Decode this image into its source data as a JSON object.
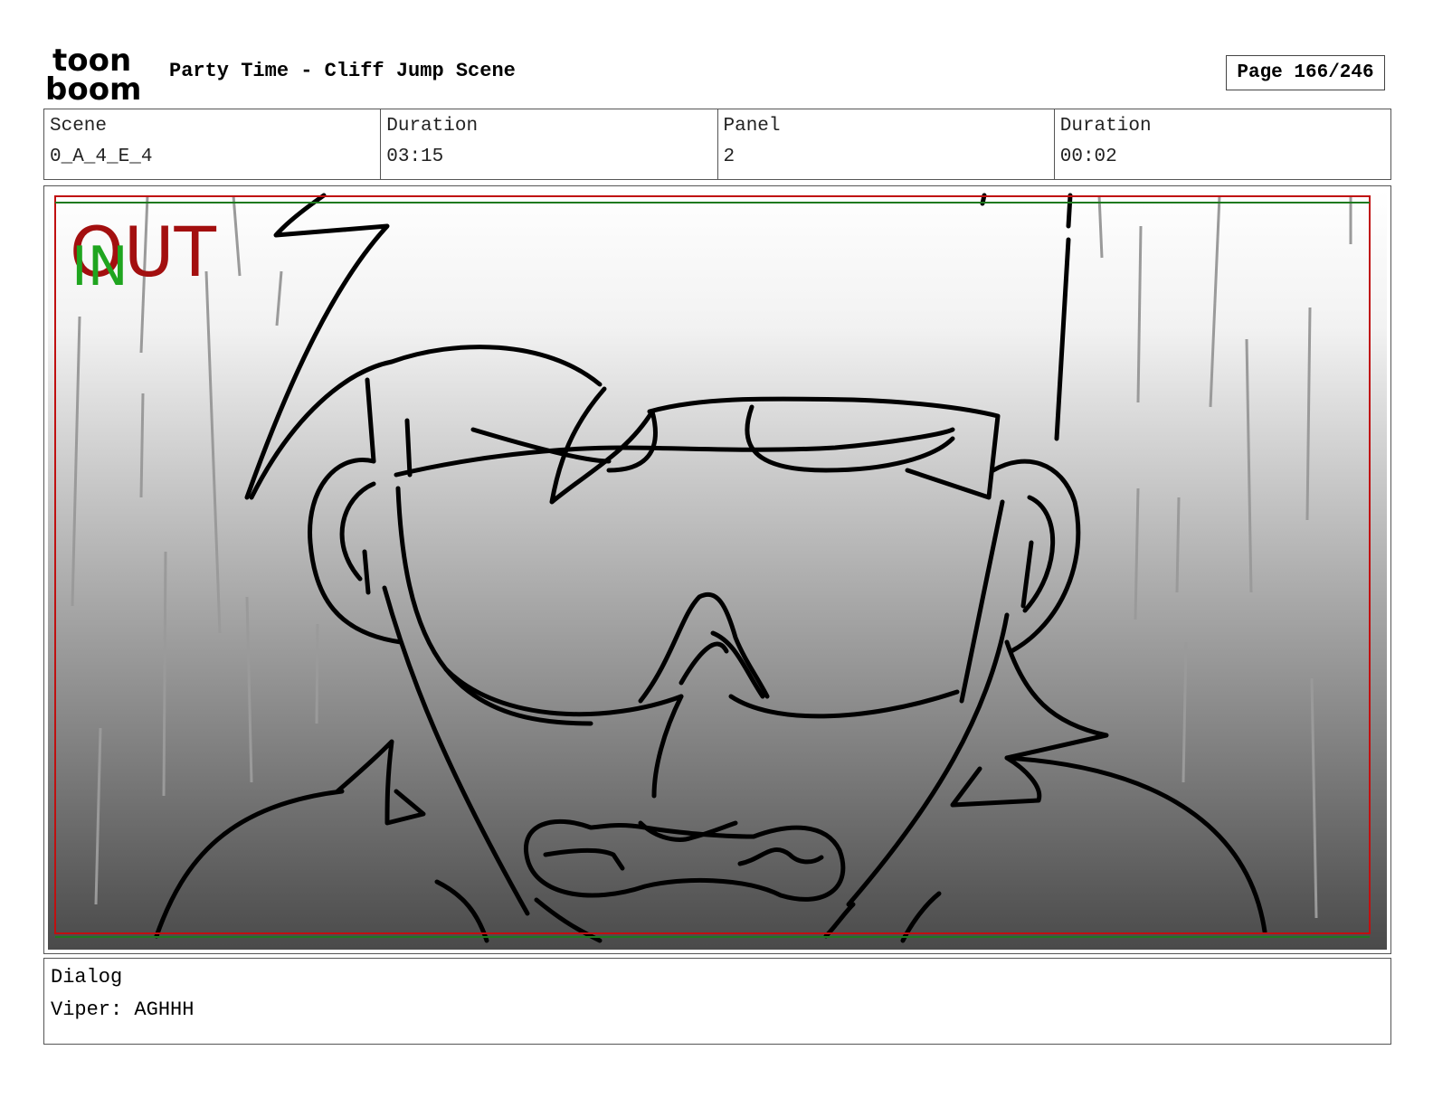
{
  "header": {
    "logo_text_top": "toon",
    "logo_text_bottom": "boom",
    "title": "Party Time - Cliff Jump Scene",
    "page": "Page 166/246"
  },
  "info": {
    "scene_label": "Scene",
    "scene_value": "0_A_4_E_4",
    "scene_duration_label": "Duration",
    "scene_duration_value": "03:15",
    "panel_label": "Panel",
    "panel_value": "2",
    "panel_duration_label": "Duration",
    "panel_duration_value": "00:02"
  },
  "panel": {
    "out_marker": "OUT",
    "in_marker": "IN",
    "colors": {
      "out": "#a30f0f",
      "in": "#1fa51f",
      "frame_red": "#c01010",
      "frame_green": "#1e7a1e"
    }
  },
  "dialog": {
    "label": "Dialog",
    "line": "Viper: AGHHH"
  }
}
